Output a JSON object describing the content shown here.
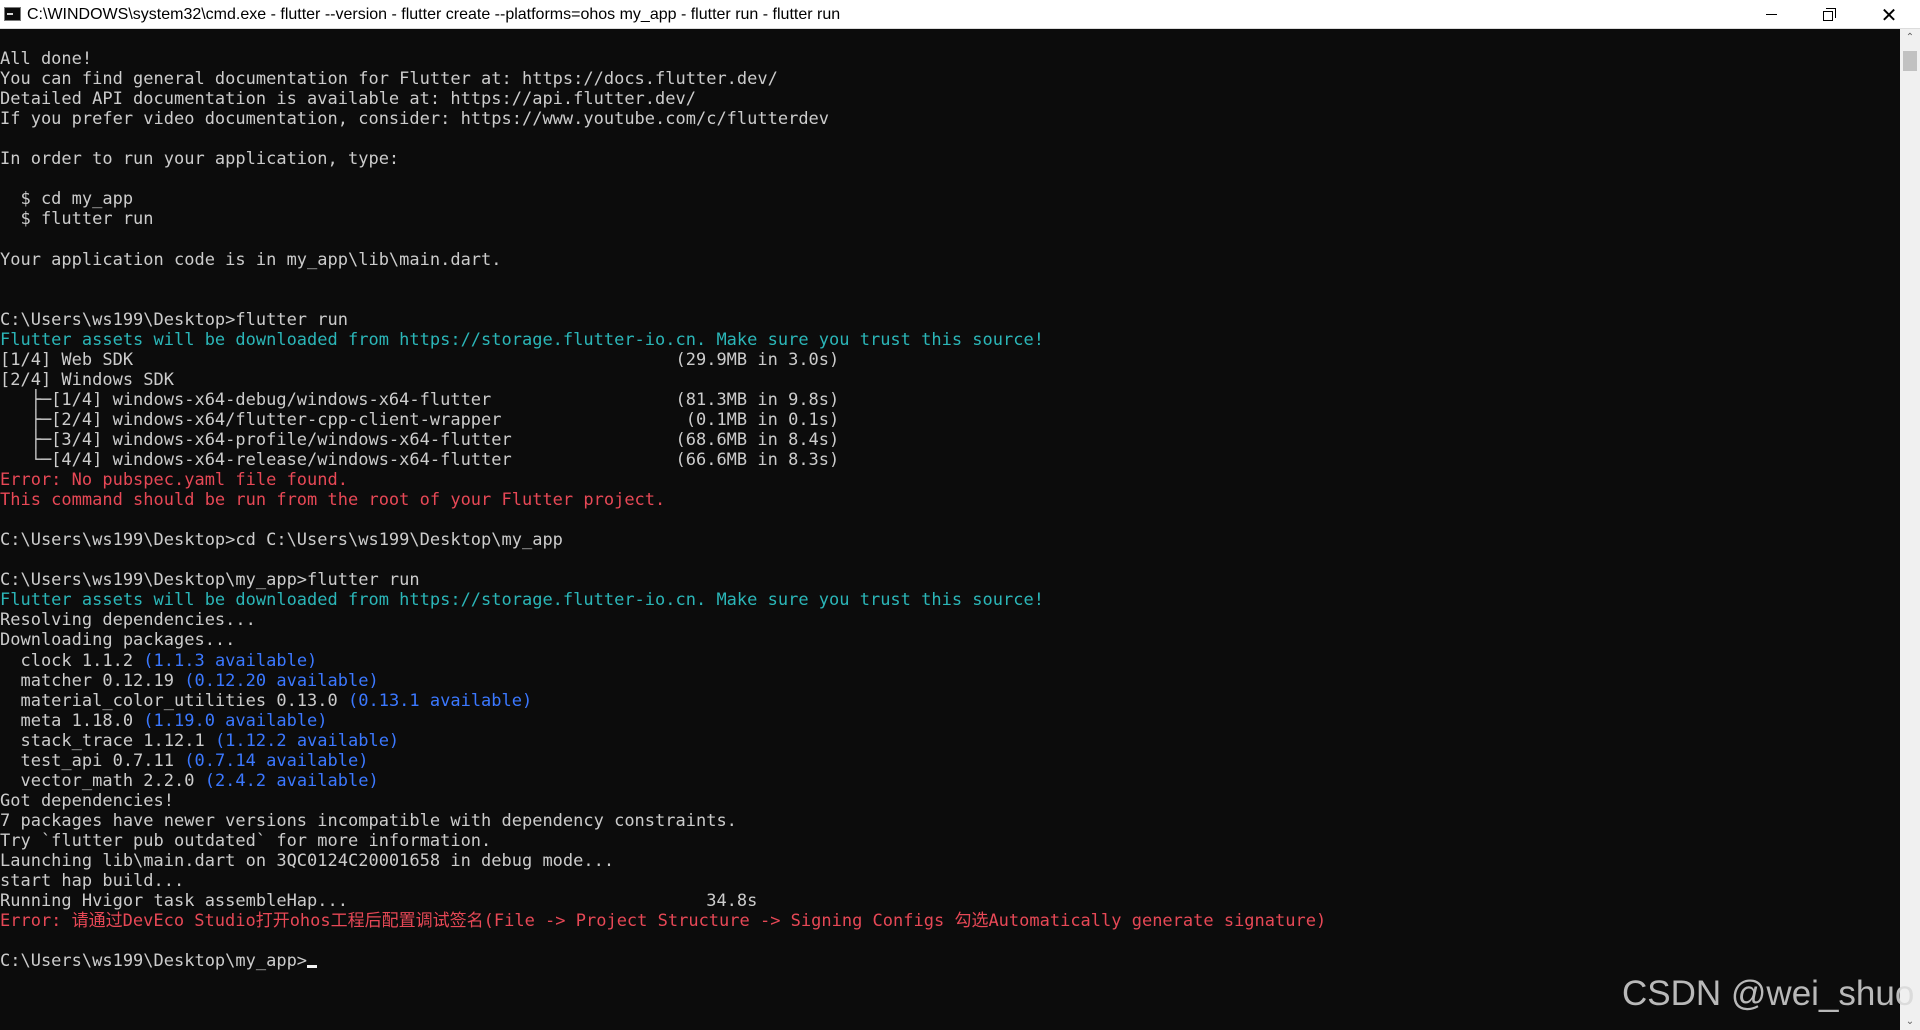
{
  "window": {
    "title": "C:\\WINDOWS\\system32\\cmd.exe - flutter  --version - flutter  create --platforms=ohos my_app - flutter  run - flutter  run",
    "icon": "cmd-icon",
    "controls": {
      "minimize": "minimize-icon",
      "maximize": "restore-icon",
      "close": "✕"
    }
  },
  "console": {
    "lines": [
      {
        "text": "All done!",
        "color": "default"
      },
      {
        "text": "You can find general documentation for Flutter at: https://docs.flutter.dev/",
        "color": "default"
      },
      {
        "text": "Detailed API documentation is available at: https://api.flutter.dev/",
        "color": "default"
      },
      {
        "text": "If you prefer video documentation, consider: https://www.youtube.com/c/flutterdev",
        "color": "default"
      },
      {
        "text": "",
        "color": "default"
      },
      {
        "text": "In order to run your application, type:",
        "color": "default"
      },
      {
        "text": "",
        "color": "default"
      },
      {
        "text": "  $ cd my_app",
        "color": "default"
      },
      {
        "text": "  $ flutter run",
        "color": "default"
      },
      {
        "text": "",
        "color": "default"
      },
      {
        "text": "Your application code is in my_app\\lib\\main.dart.",
        "color": "default"
      },
      {
        "text": "",
        "color": "default"
      },
      {
        "text": "",
        "color": "default"
      },
      {
        "text": "C:\\Users\\ws199\\Desktop>flutter run",
        "color": "default"
      },
      {
        "text": "Flutter assets will be downloaded from https://storage.flutter-io.cn. Make sure you trust this source!",
        "color": "cyan"
      },
      {
        "text": "[1/4] Web SDK                                                     (29.9MB in 3.0s)",
        "color": "default"
      },
      {
        "text": "[2/4] Windows SDK",
        "color": "default"
      },
      {
        "text": "   ├─[1/4] windows-x64-debug/windows-x64-flutter                  (81.3MB in 9.8s)",
        "color": "default"
      },
      {
        "text": "   ├─[2/4] windows-x64/flutter-cpp-client-wrapper                  (0.1MB in 0.1s)",
        "color": "default"
      },
      {
        "text": "   ├─[3/4] windows-x64-profile/windows-x64-flutter                (68.6MB in 8.4s)",
        "color": "default"
      },
      {
        "text": "   └─[4/4] windows-x64-release/windows-x64-flutter                (66.6MB in 8.3s)",
        "color": "default"
      },
      {
        "text": "Error: No pubspec.yaml file found.",
        "color": "red"
      },
      {
        "text": "This command should be run from the root of your Flutter project.",
        "color": "red"
      },
      {
        "text": "",
        "color": "default"
      },
      {
        "text": "C:\\Users\\ws199\\Desktop>cd C:\\Users\\ws199\\Desktop\\my_app",
        "color": "default"
      },
      {
        "text": "",
        "color": "default"
      },
      {
        "text": "C:\\Users\\ws199\\Desktop\\my_app>flutter run",
        "color": "default"
      },
      {
        "text": "Flutter assets will be downloaded from https://storage.flutter-io.cn. Make sure you trust this source!",
        "color": "cyan"
      },
      {
        "text": "Resolving dependencies...",
        "color": "default"
      },
      {
        "text": "Downloading packages...",
        "color": "default"
      },
      {
        "segments": [
          {
            "text": "  clock 1.1.2 ",
            "color": "default"
          },
          {
            "text": "(1.1.3 available)",
            "color": "blue"
          }
        ]
      },
      {
        "segments": [
          {
            "text": "  matcher 0.12.19 ",
            "color": "default"
          },
          {
            "text": "(0.12.20 available)",
            "color": "blue"
          }
        ]
      },
      {
        "segments": [
          {
            "text": "  material_color_utilities 0.13.0 ",
            "color": "default"
          },
          {
            "text": "(0.13.1 available)",
            "color": "blue"
          }
        ]
      },
      {
        "segments": [
          {
            "text": "  meta 1.18.0 ",
            "color": "default"
          },
          {
            "text": "(1.19.0 available)",
            "color": "blue"
          }
        ]
      },
      {
        "segments": [
          {
            "text": "  stack_trace 1.12.1 ",
            "color": "default"
          },
          {
            "text": "(1.12.2 available)",
            "color": "blue"
          }
        ]
      },
      {
        "segments": [
          {
            "text": "  test_api 0.7.11 ",
            "color": "default"
          },
          {
            "text": "(0.7.14 available)",
            "color": "blue"
          }
        ]
      },
      {
        "segments": [
          {
            "text": "  vector_math 2.2.0 ",
            "color": "default"
          },
          {
            "text": "(2.4.2 available)",
            "color": "blue"
          }
        ]
      },
      {
        "text": "Got dependencies!",
        "color": "default"
      },
      {
        "text": "7 packages have newer versions incompatible with dependency constraints.",
        "color": "default"
      },
      {
        "text": "Try `flutter pub outdated` for more information.",
        "color": "default"
      },
      {
        "text": "Launching lib\\main.dart on 3QC0124C20001658 in debug mode...",
        "color": "default"
      },
      {
        "text": "start hap build...",
        "color": "default"
      },
      {
        "text": "Running Hvigor task assembleHap...                                   34.8s",
        "color": "default"
      },
      {
        "text": "Error: 请通过DevEco Studio打开ohos工程后配置调试签名(File -> Project Structure -> Signing Configs 勾选Automatically generate signature)",
        "color": "red"
      },
      {
        "text": "",
        "color": "default"
      },
      {
        "text": "C:\\Users\\ws199\\Desktop\\my_app>",
        "color": "default",
        "cursor": true
      }
    ]
  },
  "scrollbar": {
    "up_arrow": "⌃",
    "down_arrow": "⌄"
  },
  "watermark": "CSDN @wei_shuo",
  "colors": {
    "background": "#0c0c0c",
    "default_text": "#cccccc",
    "cyan": "#2bb6b8",
    "red": "#e74856",
    "blue": "#3b78ff"
  }
}
